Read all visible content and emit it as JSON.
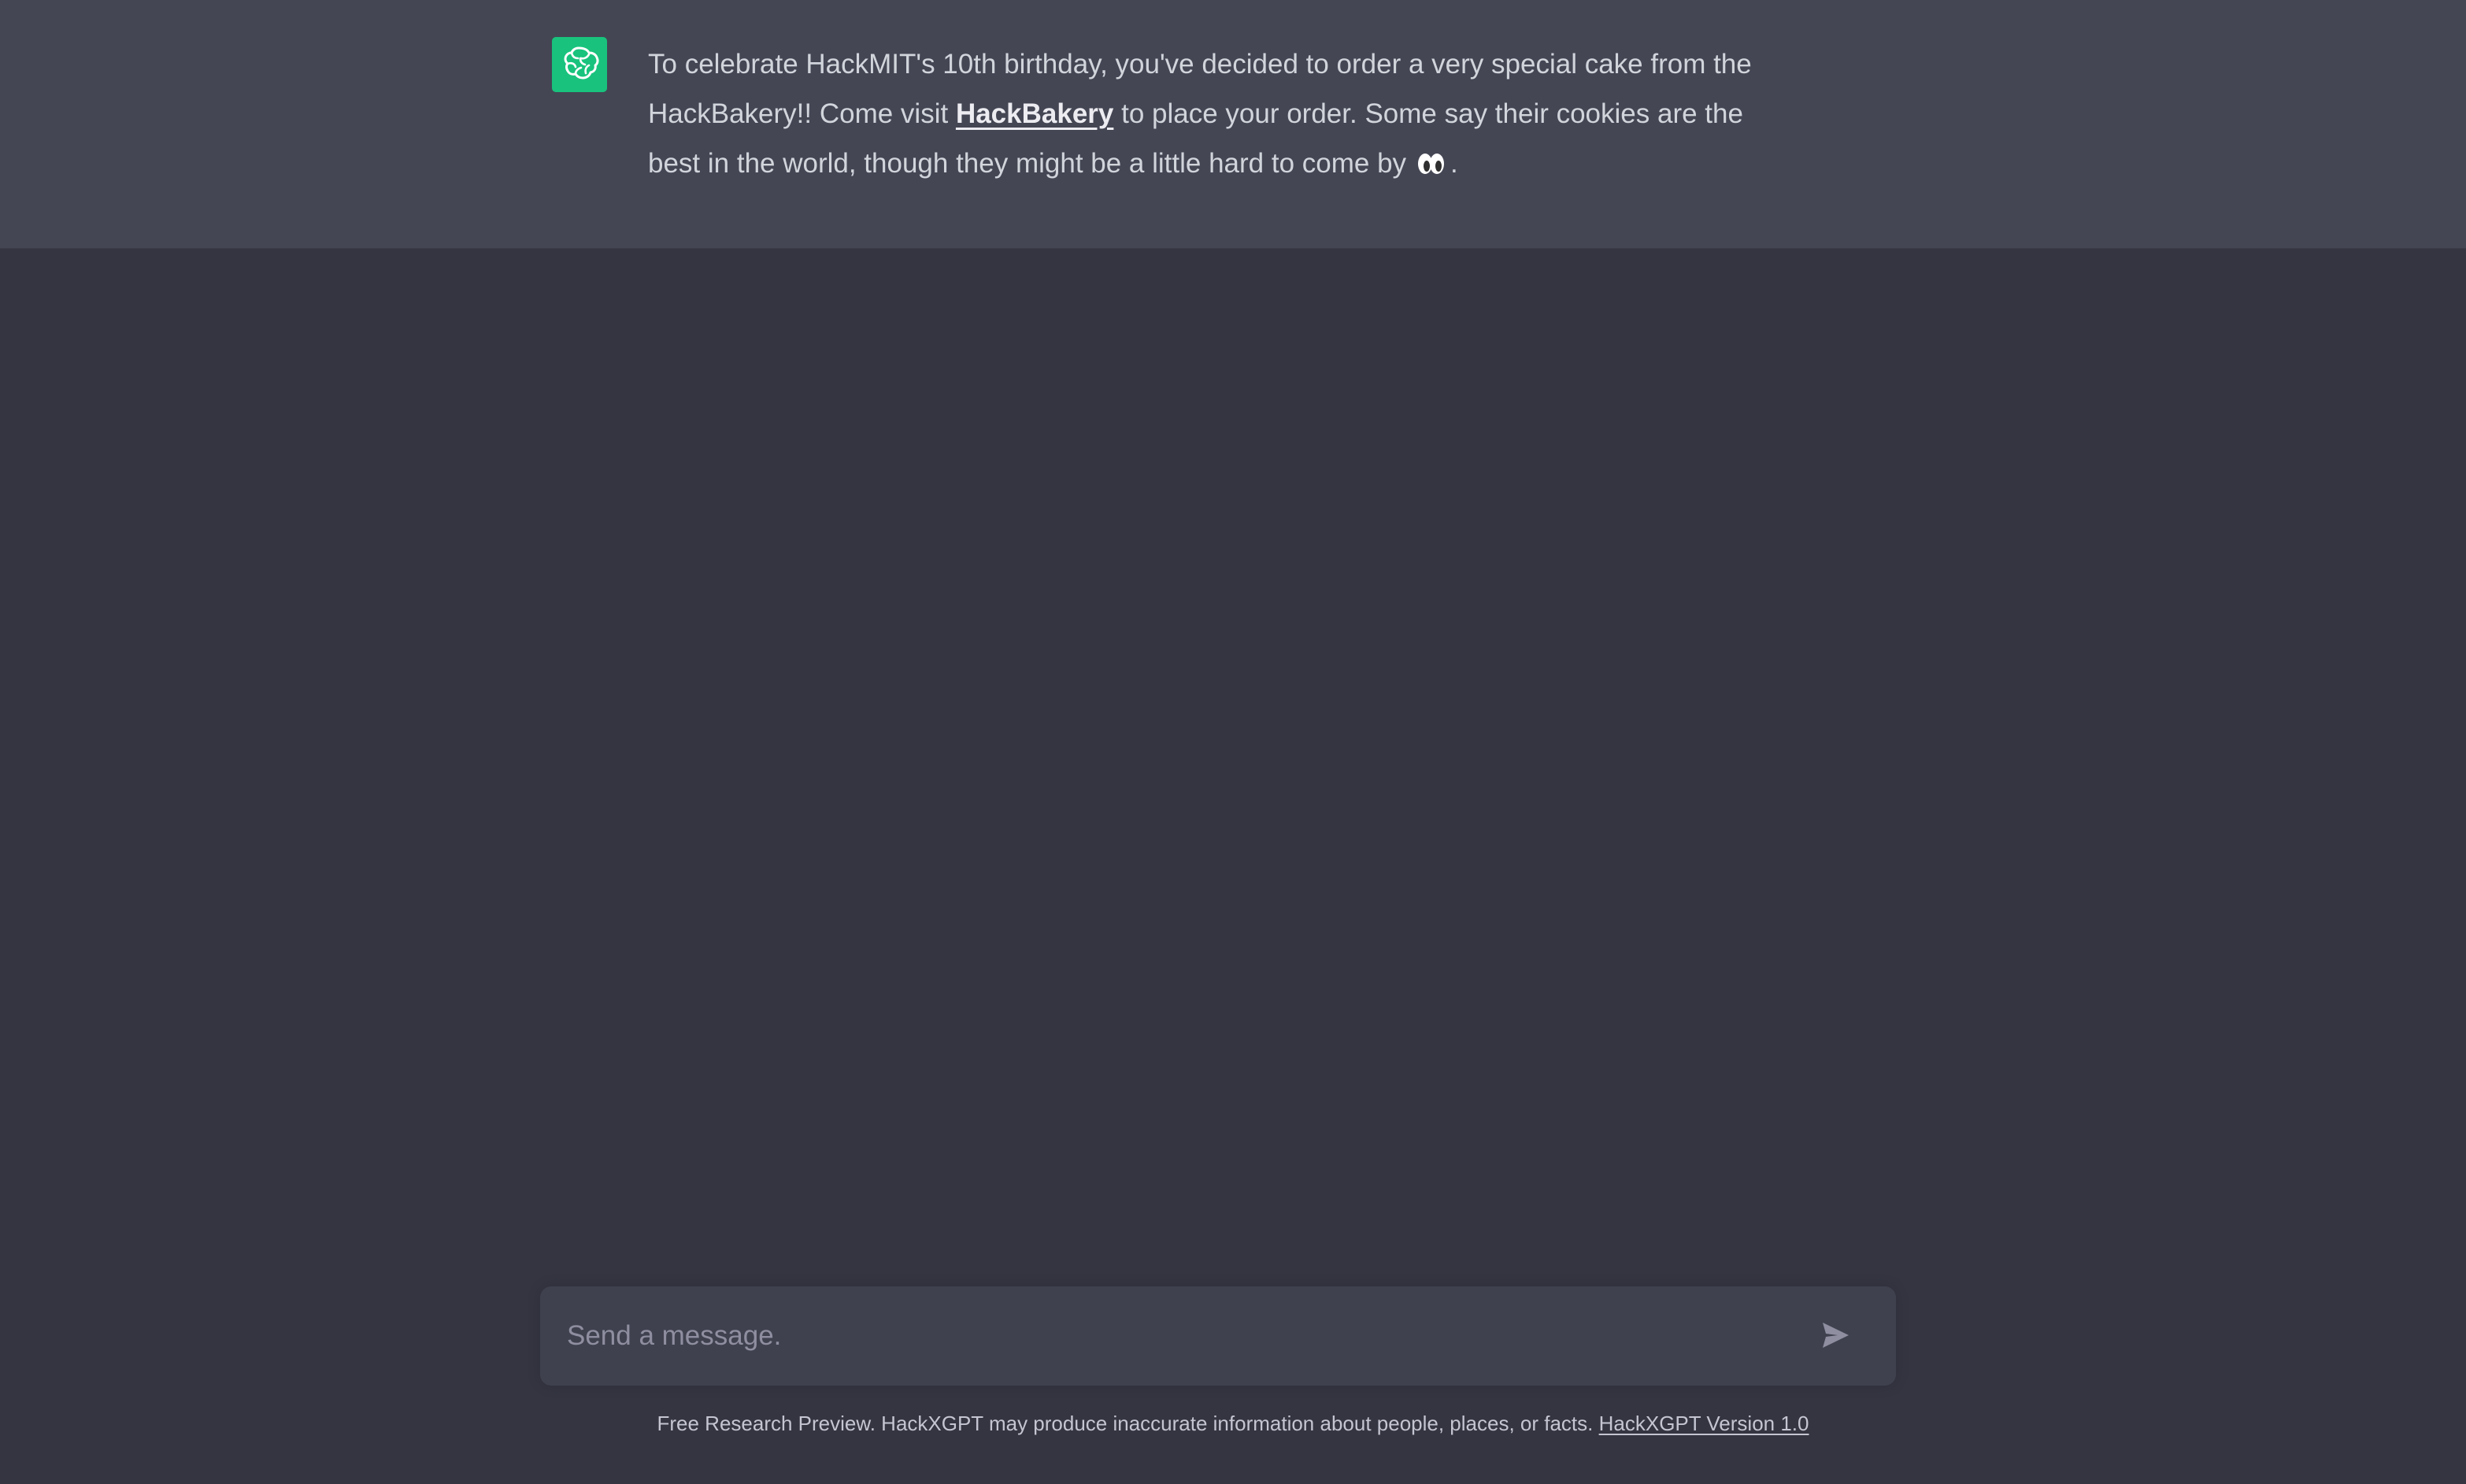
{
  "message": {
    "text_before_link": "To celebrate HackMIT's 10th birthday, you've decided to order a very special cake from the HackBakery!! Come visit ",
    "link_text": "HackBakery",
    "text_after_link": " to place your order. Some say their cookies are the best in the world, though they might be a little hard to come by",
    "emoji_icon": "eyes-icon",
    "text_end": "."
  },
  "avatar": {
    "icon": "brain-icon",
    "background": "#19c37d"
  },
  "composer": {
    "placeholder": "Send a message.",
    "send_icon": "paper-plane-icon"
  },
  "footer": {
    "note": "Free Research Preview. HackXGPT may produce inaccurate information about people, places, or facts. ",
    "version_link": "HackXGPT Version 1.0"
  },
  "colors": {
    "page_background": "#343541",
    "message_background": "#444654",
    "composer_background": "#40414f",
    "accent": "#19c37d"
  }
}
